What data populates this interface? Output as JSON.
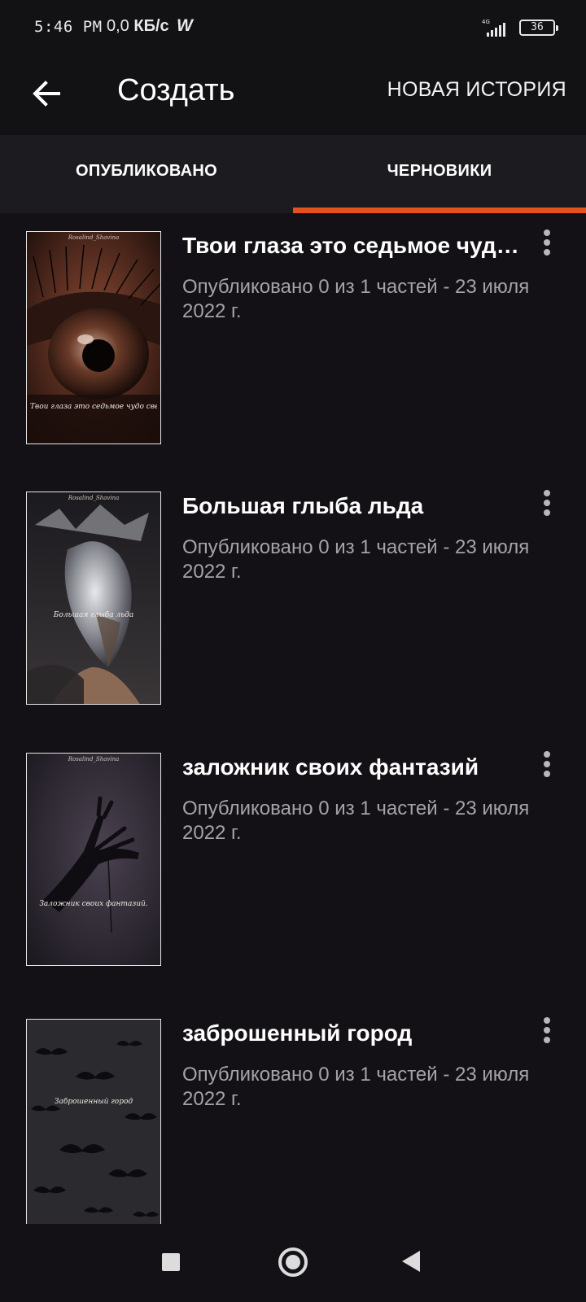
{
  "status_bar": {
    "time": "5:46 PM",
    "speed_value": "0,0",
    "speed_unit": "КБ/с",
    "app_notification": "W",
    "network": "4G",
    "battery": "36"
  },
  "app_bar": {
    "title": "Создать",
    "action_label": "НОВАЯ ИСТОРИЯ"
  },
  "tabs": [
    {
      "label": "ОПУБЛИКОВАНО",
      "selected": false
    },
    {
      "label": "ЧЕРНОВИКИ",
      "selected": true
    }
  ],
  "colors": {
    "background": "#131115",
    "tab_bar": "#1c1b1f",
    "accent": "#e2531f",
    "meta_text": "#a5a3a8"
  },
  "stories": [
    {
      "title": "Твои глаза это седьмое чудо...",
      "meta": "Опубликовано 0 из 1 частей - 23 июля 2022 г.",
      "cover_author": "Rosalind_Shavina",
      "cover_text": "Твои глаза это седьмое чудо света)"
    },
    {
      "title": "Большая глыба льда",
      "meta": "Опубликовано 0 из 1 частей - 23 июля 2022 г.",
      "cover_author": "Rosalind_Shavina",
      "cover_text": "Большая глыба льда"
    },
    {
      "title": "заложник своих фантазий",
      "meta": "Опубликовано 0 из 1 частей - 23 июля 2022 г.",
      "cover_author": "Rosalind_Shavina",
      "cover_text": "Заложник своих фантазий."
    },
    {
      "title": "заброшенный город",
      "meta": "Опубликовано 0 из 1 частей - 23 июля 2022 г.",
      "cover_author": "",
      "cover_text": "Заброшенный город"
    }
  ],
  "icons": {
    "back": "arrow-left-icon",
    "more": "more-vertical-icon",
    "nav_recents": "square-icon",
    "nav_home": "circle-icon",
    "nav_back": "triangle-back-icon"
  }
}
